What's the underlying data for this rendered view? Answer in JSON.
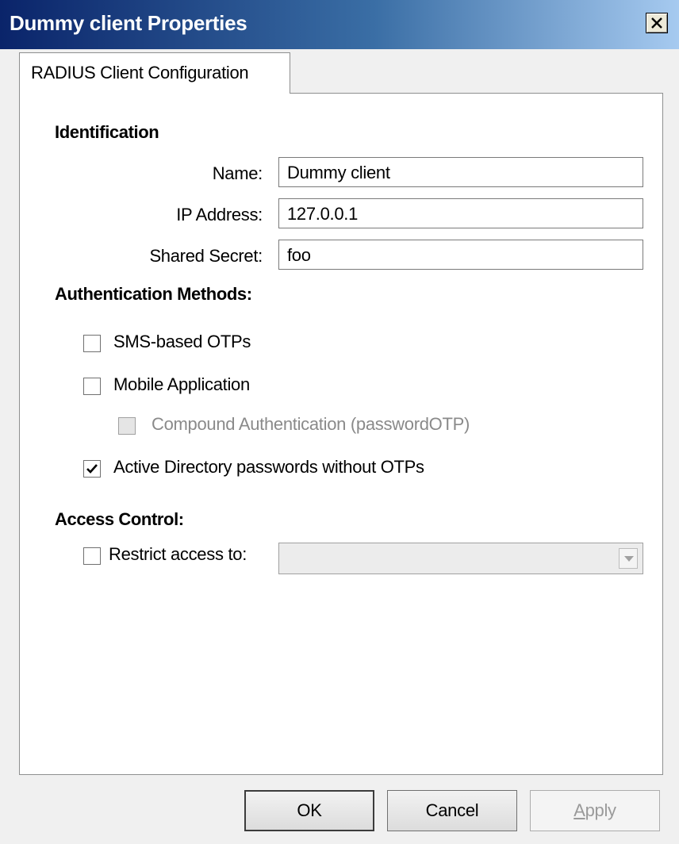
{
  "window": {
    "title": "Dummy client Properties"
  },
  "tabs": [
    {
      "label": "RADIUS Client Configuration"
    }
  ],
  "identification": {
    "heading": "Identification",
    "name_label": "Name:",
    "name_value": "Dummy client",
    "ip_label": "IP Address:",
    "ip_value": "127.0.0.1",
    "secret_label": "Shared Secret:",
    "secret_value": "foo"
  },
  "auth": {
    "heading": "Authentication Methods:",
    "sms_label": "SMS-based OTPs",
    "sms_checked": false,
    "mobile_label": "Mobile Application",
    "mobile_checked": false,
    "compound_label": "Compound Authentication (passwordOTP)",
    "compound_checked": false,
    "compound_enabled": false,
    "ad_label": "Active Directory passwords without OTPs",
    "ad_checked": true
  },
  "access": {
    "heading": "Access Control:",
    "restrict_label": "Restrict access to:",
    "restrict_checked": false,
    "restrict_value": ""
  },
  "buttons": {
    "ok": "OK",
    "cancel": "Cancel",
    "apply_first": "A",
    "apply_rest": "pply"
  },
  "colors": {
    "title_gradient_start": "#0a246a",
    "title_gradient_end": "#a6caf0",
    "disabled_text": "#8a8a8a"
  }
}
